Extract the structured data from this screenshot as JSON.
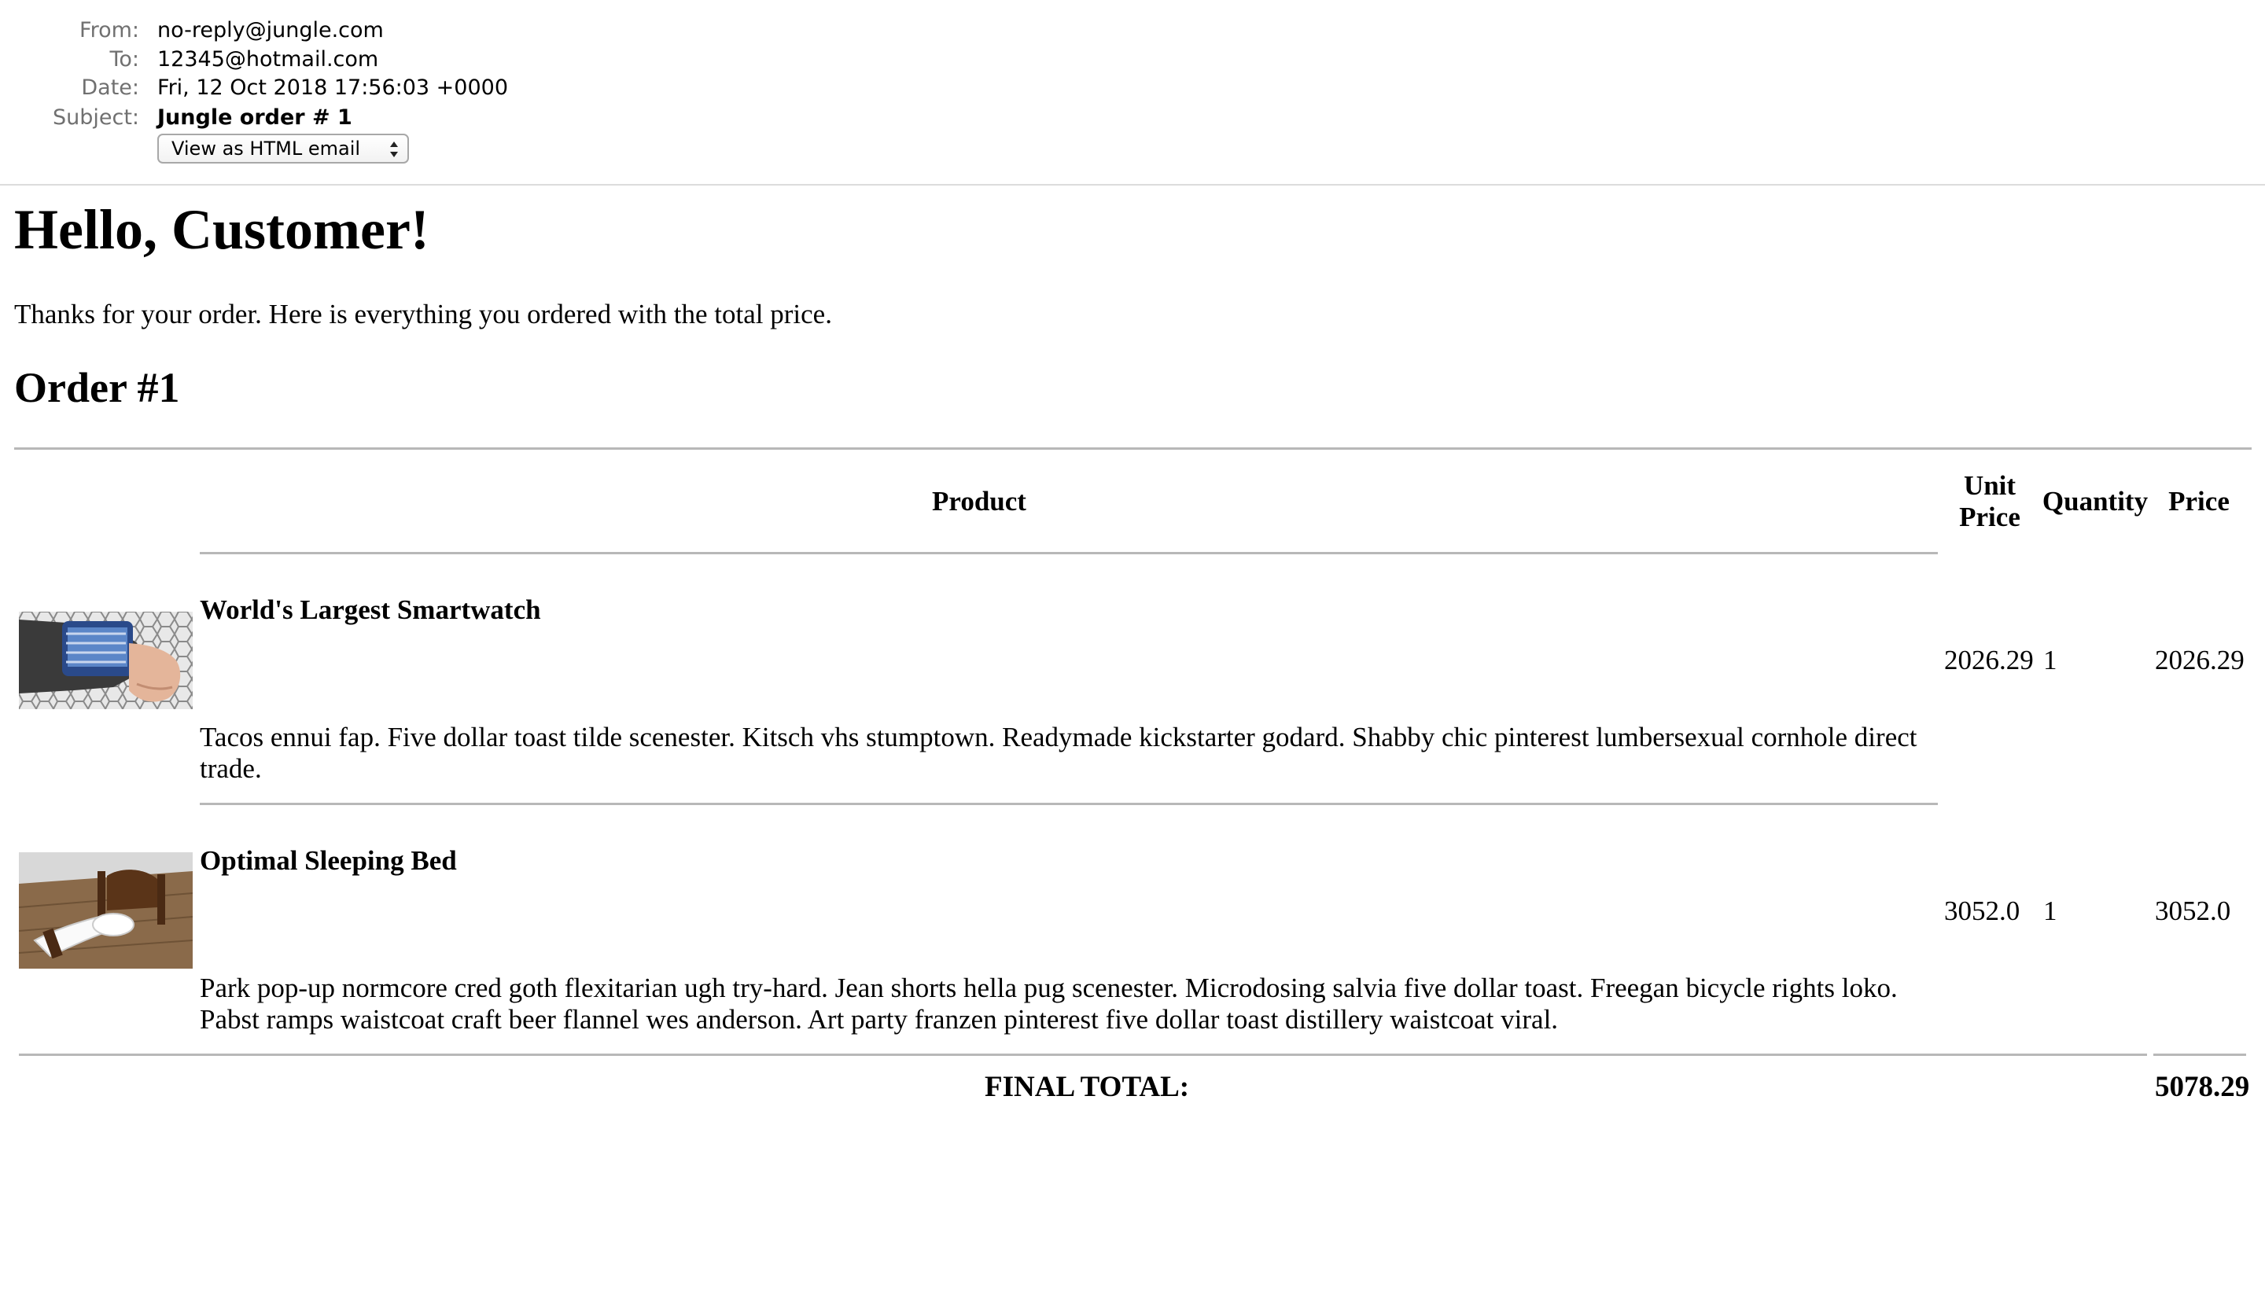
{
  "mail_header": {
    "from_label": "From:",
    "from_value": "no-reply@jungle.com",
    "to_label": "To:",
    "to_value": "12345@hotmail.com",
    "date_label": "Date:",
    "date_value": "Fri, 12 Oct 2018 17:56:03 +0000",
    "subject_label": "Subject:",
    "subject_value": "Jungle order # 1",
    "view_select": {
      "selected": "View as HTML email",
      "icon": "updown-arrows-icon"
    }
  },
  "email": {
    "greeting": "Hello, Customer!",
    "intro": "Thanks for your order. Here is everything you ordered with the total price.",
    "order_title": "Order #1",
    "table": {
      "headers": {
        "product": "Product",
        "unit_price_line1": "Unit",
        "unit_price_line2": "Price",
        "quantity": "Quantity",
        "price": "Price"
      },
      "rows": [
        {
          "name": "World's Largest Smartwatch",
          "description": "Tacos ennui fap. Five dollar toast tilde scenester. Kitsch vhs stumptown. Readymade kickstarter godard. Shabby chic pinterest lumbersexual cornhole direct trade.",
          "unit_price": "2026.29",
          "quantity": "1",
          "price": "2026.29",
          "image": "smartwatch-photo"
        },
        {
          "name": "Optimal Sleeping Bed",
          "description": "Park pop-up normcore cred goth flexitarian ugh try-hard. Jean shorts hella pug scenester. Microdosing salvia five dollar toast. Freegan bicycle rights loko. Pabst ramps waistcoat craft beer flannel wes anderson. Art party franzen pinterest five dollar toast distillery waistcoat viral.",
          "unit_price": "3052.0",
          "quantity": "1",
          "price": "3052.0",
          "image": "bed-photo"
        }
      ],
      "final_total_label": "FINAL TOTAL:",
      "final_total_value": "5078.29"
    }
  }
}
